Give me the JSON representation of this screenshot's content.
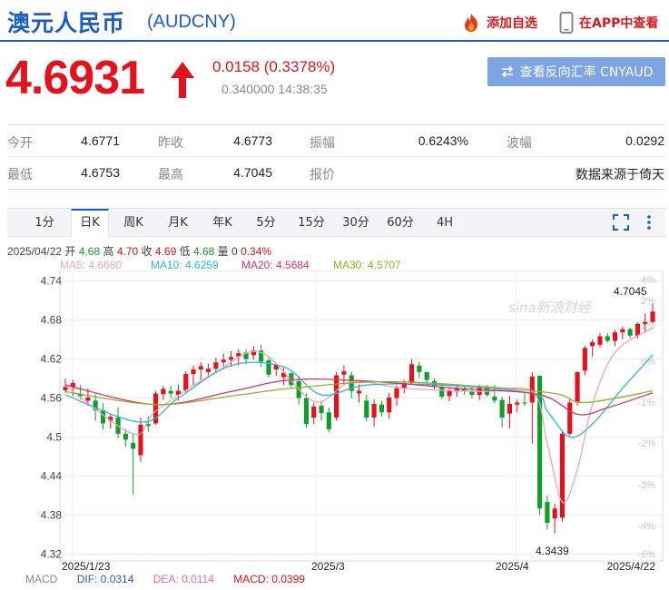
{
  "header": {
    "title_cn": "澳元人民币",
    "title_code": "(AUDCNY)",
    "fav_label": "添加自选",
    "app_label": "在APP中查看"
  },
  "quote": {
    "price": "4.6931",
    "change": "0.0158 (0.3378%)",
    "subline": "0.340000 14:38:35",
    "reverse_label": "查看反向汇率 CNYAUD",
    "direction": "up",
    "up_color": "#e3121d",
    "down_color": "#0f9d2c"
  },
  "stats": {
    "row1": [
      {
        "label": "今开",
        "value": "4.6771"
      },
      {
        "label": "昨收",
        "value": "4.6773"
      },
      {
        "label": "振幅",
        "value": "0.6243%"
      },
      {
        "label": "波幅",
        "value": "0.0292"
      }
    ],
    "row2": [
      {
        "label": "最低",
        "value": "4.6753"
      },
      {
        "label": "最高",
        "value": "4.7045"
      },
      {
        "label": "报价",
        "value": ""
      },
      {
        "label": "",
        "value": "数据来源于倚天"
      }
    ]
  },
  "tabs": [
    "1分",
    "日K",
    "周K",
    "月K",
    "年K",
    "5分",
    "15分",
    "30分",
    "60分",
    "4H"
  ],
  "active_tab": "日K",
  "toolbar_icons": [
    "fullscreen-icon",
    "more-vertical-icon"
  ],
  "info": {
    "date": "2025/04/22",
    "open_label": "开",
    "open": "4.68",
    "high_label": "高",
    "high": "4.70",
    "close_label": "收",
    "close": "4.69",
    "low_label": "低",
    "low": "4.68",
    "vol_label": "量",
    "vol": "0",
    "pct": "0.34%"
  },
  "ma": [
    {
      "label": "MA5: 4.6680",
      "color": "#f2a3b8"
    },
    {
      "label": "MA10: 4.6259",
      "color": "#2ab7dc"
    },
    {
      "label": "MA20: 4.5684",
      "color": "#d6336c"
    },
    {
      "label": "MA30: 4.5707",
      "color": "#96ae28"
    }
  ],
  "macd": [
    {
      "label": "MACD",
      "color": "#8a8a8a"
    },
    {
      "label": "DIF: 0.0314",
      "color": "#2f55d4"
    },
    {
      "label": "DEA: 0.0114",
      "color": "#e36fa8"
    },
    {
      "label": "MACD: 0.0399",
      "color": "#e3121d"
    }
  ],
  "watermark": "sina新浪财经",
  "chart_data": {
    "type": "candlestick",
    "y_ticks": [
      "4.74",
      "4.68",
      "4.62",
      "4.56",
      "4.5",
      "4.44",
      "4.38",
      "4.32"
    ],
    "y_pct_ticks": [
      "4%",
      "2%",
      "1%",
      "0%",
      "-1%",
      "-2%",
      "-3%",
      "-4%",
      "-6%"
    ],
    "x_labels": [
      "2025/1/23",
      "2025/3",
      "2025/4",
      "2025/4/22"
    ],
    "ylim": [
      4.315,
      4.745
    ],
    "high_label": "4.7045",
    "low_label": "4.3439",
    "candles": [
      [
        4.572,
        4.59,
        4.568,
        4.577
      ],
      [
        4.577,
        4.588,
        4.563,
        4.583
      ],
      [
        4.566,
        4.58,
        4.558,
        4.563
      ],
      [
        4.556,
        4.575,
        4.548,
        4.561
      ],
      [
        4.556,
        4.566,
        4.525,
        4.541
      ],
      [
        4.541,
        4.552,
        4.512,
        4.521
      ],
      [
        4.525,
        4.536,
        4.513,
        4.531
      ],
      [
        4.53,
        4.546,
        4.498,
        4.505
      ],
      [
        4.505,
        4.513,
        4.485,
        4.496
      ],
      [
        4.491,
        4.506,
        4.412,
        4.482
      ],
      [
        4.472,
        4.53,
        4.462,
        4.519
      ],
      [
        4.52,
        4.532,
        4.508,
        4.517
      ],
      [
        4.521,
        4.571,
        4.519,
        4.567
      ],
      [
        4.566,
        4.579,
        4.557,
        4.574
      ],
      [
        4.571,
        4.579,
        4.56,
        4.567
      ],
      [
        4.565,
        4.581,
        4.556,
        4.571
      ],
      [
        4.572,
        4.601,
        4.569,
        4.597
      ],
      [
        4.597,
        4.61,
        4.58,
        4.604
      ],
      [
        4.604,
        4.615,
        4.588,
        4.609
      ],
      [
        4.6,
        4.613,
        4.595,
        4.605
      ],
      [
        4.605,
        4.622,
        4.598,
        4.615
      ],
      [
        4.615,
        4.628,
        4.605,
        4.619
      ],
      [
        4.619,
        4.632,
        4.608,
        4.623
      ],
      [
        4.624,
        4.635,
        4.61,
        4.629
      ],
      [
        4.63,
        4.635,
        4.612,
        4.62
      ],
      [
        4.626,
        4.64,
        4.619,
        4.633
      ],
      [
        4.633,
        4.642,
        4.608,
        4.616
      ],
      [
        4.618,
        4.622,
        4.592,
        4.596
      ],
      [
        4.604,
        4.614,
        4.594,
        4.611
      ],
      [
        4.592,
        4.607,
        4.58,
        4.599
      ],
      [
        4.598,
        4.6,
        4.575,
        4.58
      ],
      [
        4.586,
        4.594,
        4.55,
        4.56
      ],
      [
        4.56,
        4.567,
        4.514,
        4.52
      ],
      [
        4.53,
        4.553,
        4.52,
        4.547
      ],
      [
        4.548,
        4.556,
        4.525,
        4.537
      ],
      [
        4.538,
        4.545,
        4.507,
        4.512
      ],
      [
        4.53,
        4.6,
        4.525,
        4.595
      ],
      [
        4.596,
        4.61,
        4.58,
        4.601
      ],
      [
        4.595,
        4.6,
        4.56,
        4.571
      ],
      [
        4.567,
        4.581,
        4.553,
        4.571
      ],
      [
        4.556,
        4.565,
        4.524,
        4.53
      ],
      [
        4.53,
        4.558,
        4.516,
        4.551
      ],
      [
        4.55,
        4.556,
        4.532,
        4.538
      ],
      [
        4.538,
        4.568,
        4.528,
        4.561
      ],
      [
        4.56,
        4.58,
        4.548,
        4.575
      ],
      [
        4.575,
        4.588,
        4.567,
        4.583
      ],
      [
        4.583,
        4.62,
        4.58,
        4.612
      ],
      [
        4.61,
        4.616,
        4.59,
        4.6
      ],
      [
        4.6,
        4.6,
        4.578,
        4.588
      ],
      [
        4.586,
        4.59,
        4.573,
        4.577
      ],
      [
        4.577,
        4.58,
        4.558,
        4.562
      ],
      [
        4.563,
        4.576,
        4.555,
        4.571
      ],
      [
        4.57,
        4.58,
        4.562,
        4.575
      ],
      [
        4.575,
        4.58,
        4.565,
        4.57
      ],
      [
        4.57,
        4.577,
        4.56,
        4.565
      ],
      [
        4.565,
        4.58,
        4.557,
        4.578
      ],
      [
        4.578,
        4.58,
        4.562,
        4.565
      ],
      [
        4.562,
        4.58,
        4.552,
        4.556
      ],
      [
        4.557,
        4.562,
        4.515,
        4.53
      ],
      [
        4.536,
        4.563,
        4.513,
        4.551
      ],
      [
        4.55,
        4.558,
        4.538,
        4.553
      ],
      [
        4.553,
        4.567,
        4.548,
        4.552
      ],
      [
        4.553,
        4.6,
        4.49,
        4.593
      ],
      [
        4.594,
        4.595,
        4.38,
        4.39
      ],
      [
        4.4,
        4.41,
        4.358,
        4.368
      ],
      [
        4.375,
        4.398,
        4.352,
        4.39
      ],
      [
        4.376,
        4.51,
        4.37,
        4.505
      ],
      [
        4.505,
        4.56,
        4.502,
        4.553
      ],
      [
        4.553,
        4.6,
        4.548,
        4.6
      ],
      [
        4.602,
        4.64,
        4.595,
        4.637
      ],
      [
        4.64,
        4.65,
        4.624,
        4.646
      ],
      [
        4.642,
        4.66,
        4.638,
        4.655
      ],
      [
        4.655,
        4.66,
        4.645,
        4.648
      ],
      [
        4.648,
        4.665,
        4.64,
        4.661
      ],
      [
        4.661,
        4.67,
        4.65,
        4.666
      ],
      [
        4.666,
        4.668,
        4.652,
        4.656
      ],
      [
        4.656,
        4.676,
        4.652,
        4.674
      ],
      [
        4.674,
        4.69,
        4.66,
        4.677
      ],
      [
        4.677,
        4.705,
        4.675,
        4.693
      ]
    ],
    "ma_series": {
      "MA5": [
        [
          0,
          4.579
        ],
        [
          9,
          4.505
        ],
        [
          12,
          4.54
        ],
        [
          20,
          4.6
        ],
        [
          26,
          4.63
        ],
        [
          33,
          4.555
        ],
        [
          38,
          4.585
        ],
        [
          45,
          4.575
        ],
        [
          55,
          4.57
        ],
        [
          62,
          4.57
        ],
        [
          64,
          4.49
        ],
        [
          66,
          4.4
        ],
        [
          68,
          4.45
        ],
        [
          70,
          4.55
        ],
        [
          73,
          4.63
        ],
        [
          78,
          4.668
        ]
      ],
      "MA10": [
        [
          0,
          4.565
        ],
        [
          10,
          4.523
        ],
        [
          15,
          4.56
        ],
        [
          22,
          4.61
        ],
        [
          29,
          4.608
        ],
        [
          34,
          4.565
        ],
        [
          40,
          4.58
        ],
        [
          50,
          4.58
        ],
        [
          62,
          4.567
        ],
        [
          64,
          4.54
        ],
        [
          67,
          4.5
        ],
        [
          70,
          4.52
        ],
        [
          74,
          4.575
        ],
        [
          78,
          4.626
        ]
      ],
      "MA20": [
        [
          0,
          4.58
        ],
        [
          12,
          4.55
        ],
        [
          22,
          4.57
        ],
        [
          30,
          4.588
        ],
        [
          40,
          4.586
        ],
        [
          52,
          4.575
        ],
        [
          63,
          4.565
        ],
        [
          68,
          4.535
        ],
        [
          72,
          4.545
        ],
        [
          78,
          4.568
        ]
      ],
      "MA30": [
        [
          0,
          4.57
        ],
        [
          12,
          4.55
        ],
        [
          22,
          4.563
        ],
        [
          30,
          4.575
        ],
        [
          42,
          4.585
        ],
        [
          55,
          4.578
        ],
        [
          65,
          4.567
        ],
        [
          69,
          4.553
        ],
        [
          78,
          4.571
        ]
      ]
    }
  }
}
